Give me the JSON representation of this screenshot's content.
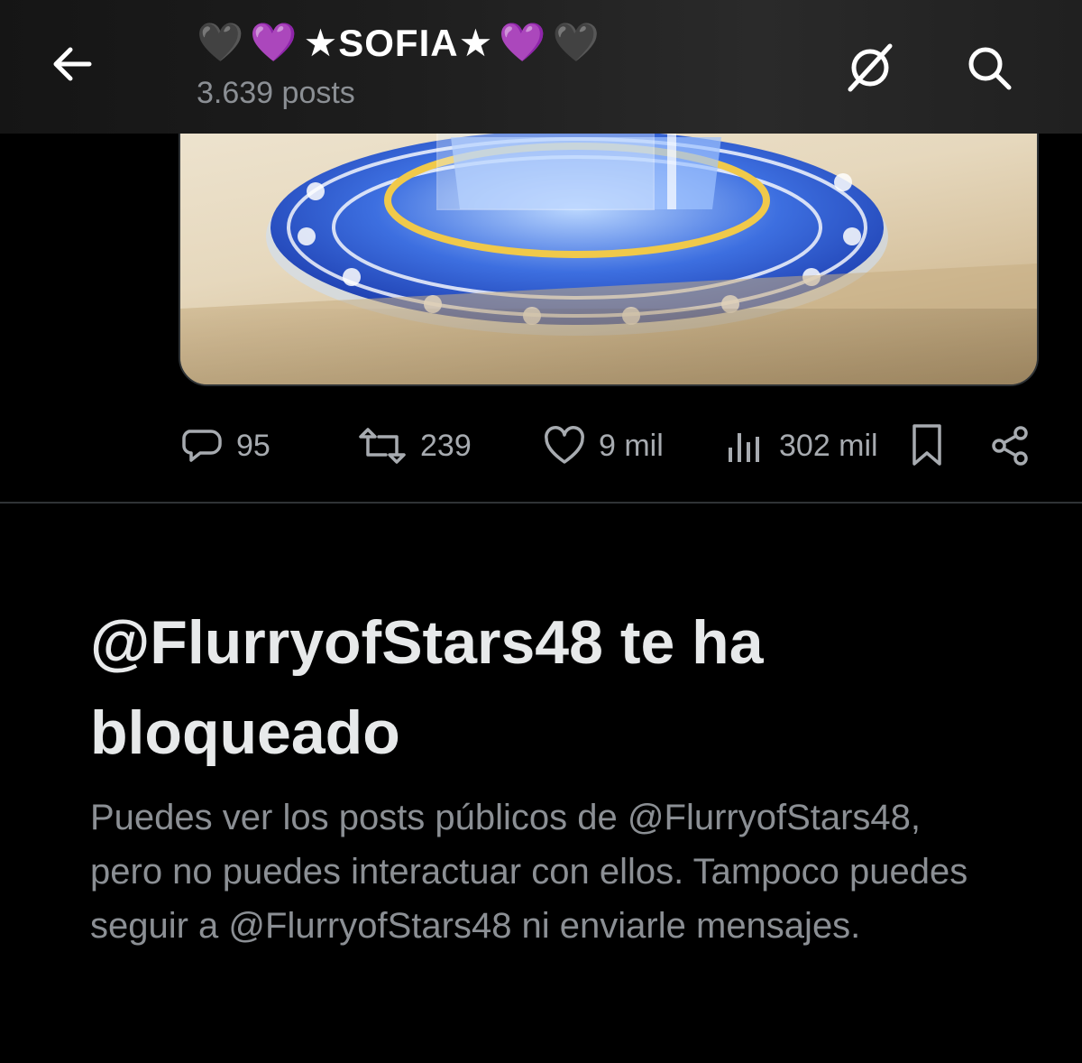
{
  "header": {
    "back_label": "←",
    "title_prefix_emojis": [
      "🖤",
      "💜"
    ],
    "title_name": "★SOFIA★",
    "title_suffix_emojis": [
      "💜",
      "🖤"
    ],
    "post_count": "3.639 posts"
  },
  "actions": {
    "replies": "95",
    "reposts": "239",
    "likes": "9 mil",
    "views": "302 mil"
  },
  "notice": {
    "title": "@FlurryofStars48 te ha bloqueado",
    "description": "Puedes ver los posts públicos de @FlurryofStars48, pero no puedes interactuar con ellos. Tampoco puedes seguir a @FlurryofStars48 ni enviarle mensajes."
  },
  "colors": {
    "background": "#000000",
    "text_primary": "#e7e9ea",
    "text_secondary": "#8b8f94",
    "divider": "#2f3336"
  },
  "icons": {
    "back": "arrow-left-icon",
    "grok": "grok-icon",
    "search": "search-icon",
    "reply": "reply-icon",
    "repost": "repost-icon",
    "like": "heart-icon",
    "views": "views-icon",
    "bookmark": "bookmark-icon",
    "share": "share-icon"
  }
}
